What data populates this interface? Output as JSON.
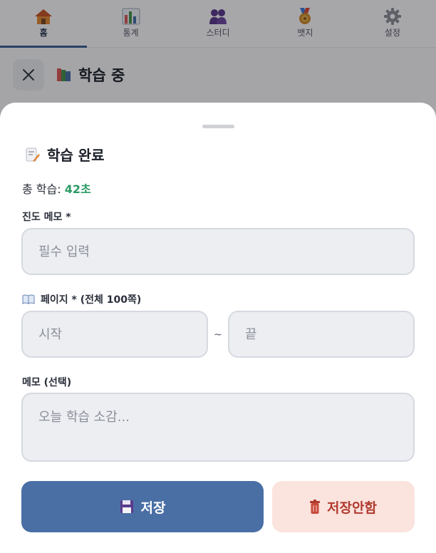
{
  "nav": {
    "items": [
      {
        "label": "홈",
        "icon": "house-icon",
        "active": true
      },
      {
        "label": "통계",
        "icon": "bar-chart-icon",
        "active": false
      },
      {
        "label": "스터디",
        "icon": "people-icon",
        "active": false
      },
      {
        "label": "뱃지",
        "icon": "medal-icon",
        "active": false
      },
      {
        "label": "설정",
        "icon": "gear-icon",
        "active": false
      }
    ]
  },
  "header": {
    "title": "학습 중",
    "title_icon": "books-icon",
    "close_icon": "close-icon"
  },
  "sheet": {
    "title": "학습 완료",
    "title_icon": "memo-icon",
    "total_label": "총 학습:",
    "total_value": "42초",
    "progress_memo": {
      "label": "진도 메모 *",
      "placeholder": "필수 입력",
      "value": ""
    },
    "pages": {
      "label": "페이지 * (전체 100쪽)",
      "label_icon": "open-book-icon",
      "start_placeholder": "시작",
      "separator": "~",
      "end_placeholder": "끝"
    },
    "memo": {
      "label": "메모 (선택)",
      "placeholder": "오늘 학습 소감..."
    },
    "save_button": {
      "label": "저장",
      "icon": "floppy-disk-icon"
    },
    "discard_button": {
      "label": "저장안함",
      "icon": "trash-icon"
    }
  },
  "colors": {
    "accent": "#4a6fa5",
    "total_value": "#2b9a63",
    "discard_text": "#b03a2e",
    "discard_bg": "#fbe3de"
  }
}
